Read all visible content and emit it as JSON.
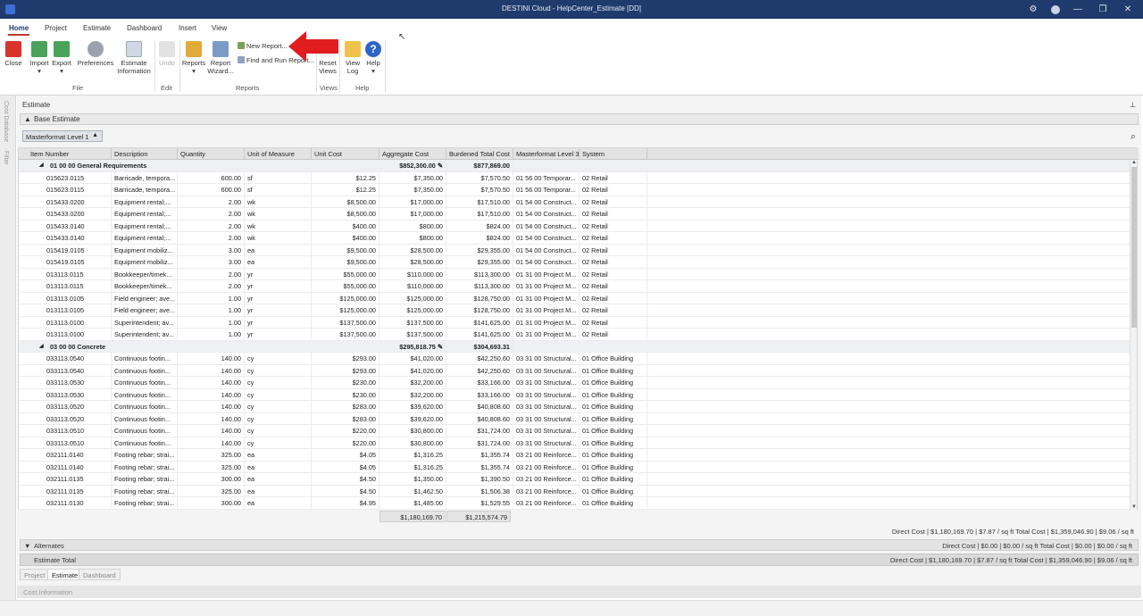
{
  "window": {
    "title": "DESTINI Cloud - HelpCenter_Estimate [DD]",
    "controls": [
      "—",
      "❐",
      "✕"
    ]
  },
  "menu": {
    "tabs": [
      "Home",
      "Project",
      "Estimate",
      "Dashboard",
      "Insert",
      "View"
    ],
    "active": "Home"
  },
  "ribbon": {
    "close": "Close",
    "import": "Import",
    "export": "Export",
    "preferences": "Preferences",
    "estimate_info": "Estimate Information",
    "undo": "Undo",
    "reports": "Reports",
    "report_wizard": "Report Wizard...",
    "new_report": "New Report...",
    "find_run_report": "Find and Run Report...",
    "reset_views": "Reset Views",
    "view_log": "View Log",
    "help": "Help",
    "groups": {
      "file": "File",
      "edit": "Edit",
      "reports": "Reports",
      "views": "Views",
      "help": "Help"
    }
  },
  "sidebar": {
    "cost_database": "Cost Database",
    "filter": "Filter"
  },
  "panel": {
    "title": "Estimate",
    "pin": "⊥",
    "base_estimate": "Base Estimate",
    "level_dropdown": "Masterformat Level 1"
  },
  "grid": {
    "columns": [
      "Item Number",
      "Description",
      "Quantity",
      "Unit of Measure",
      "Unit Cost",
      "Aggregate Cost",
      "Burdened Total Cost",
      "Masterformat Level 3",
      "System"
    ],
    "groups": [
      {
        "name": "01 00 00 General Requirements",
        "aggregate": "$852,300.00",
        "burdened": "$877,869.00",
        "rows": [
          [
            "015623.0115",
            "Barricade, tempora...",
            "600.00",
            "sf",
            "$12.25",
            "$7,350.00",
            "$7,570.50",
            "01 56 00 Temporar...",
            "02 Retail"
          ],
          [
            "015623.0115",
            "Barricade, tempora...",
            "600.00",
            "sf",
            "$12.25",
            "$7,350.00",
            "$7,570.50",
            "01 56 00 Temporar...",
            "02 Retail"
          ],
          [
            "015433.0200",
            "Equipment rental;...",
            "2.00",
            "wk",
            "$8,500.00",
            "$17,000.00",
            "$17,510.00",
            "01 54 00 Construct...",
            "02 Retail"
          ],
          [
            "015433.0200",
            "Equipment rental;...",
            "2.00",
            "wk",
            "$8,500.00",
            "$17,000.00",
            "$17,510.00",
            "01 54 00 Construct...",
            "02 Retail"
          ],
          [
            "015433.0140",
            "Equipment rental;...",
            "2.00",
            "wk",
            "$400.00",
            "$800.00",
            "$824.00",
            "01 54 00 Construct...",
            "02 Retail"
          ],
          [
            "015433.0140",
            "Equipment rental;...",
            "2.00",
            "wk",
            "$400.00",
            "$800.00",
            "$824.00",
            "01 54 00 Construct...",
            "02 Retail"
          ],
          [
            "015419.0105",
            "Equipment mobiliz...",
            "3.00",
            "ea",
            "$9,500.00",
            "$28,500.00",
            "$29,355.00",
            "01 54 00 Construct...",
            "02 Retail"
          ],
          [
            "015419.0105",
            "Equipment mobiliz...",
            "3.00",
            "ea",
            "$9,500.00",
            "$28,500.00",
            "$29,355.00",
            "01 54 00 Construct...",
            "02 Retail"
          ],
          [
            "013113.0115",
            "Bookkeeper/timek...",
            "2.00",
            "yr",
            "$55,000.00",
            "$110,000.00",
            "$113,300.00",
            "01 31 00 Project M...",
            "02 Retail"
          ],
          [
            "013113.0115",
            "Bookkeeper/timek...",
            "2.00",
            "yr",
            "$55,000.00",
            "$110,000.00",
            "$113,300.00",
            "01 31 00 Project M...",
            "02 Retail"
          ],
          [
            "013113.0105",
            "Field engineer; ave...",
            "1.00",
            "yr",
            "$125,000.00",
            "$125,000.00",
            "$128,750.00",
            "01 31 00 Project M...",
            "02 Retail"
          ],
          [
            "013113.0105",
            "Field engineer; ave...",
            "1.00",
            "yr",
            "$125,000.00",
            "$125,000.00",
            "$128,750.00",
            "01 31 00 Project M...",
            "02 Retail"
          ],
          [
            "013113.0100",
            "Superintendent; av...",
            "1.00",
            "yr",
            "$137,500.00",
            "$137,500.00",
            "$141,625.00",
            "01 31 00 Project M...",
            "02 Retail"
          ],
          [
            "013113.0100",
            "Superintendent; av...",
            "1.00",
            "yr",
            "$137,500.00",
            "$137,500.00",
            "$141,625.00",
            "01 31 00 Project M...",
            "02 Retail"
          ]
        ]
      },
      {
        "name": "03 00 00 Concrete",
        "aggregate": "$295,818.75",
        "burdened": "$304,693.31",
        "rows": [
          [
            "033113.0540",
            "Continuous footin...",
            "140.00",
            "cy",
            "$293.00",
            "$41,020.00",
            "$42,250.60",
            "03 31 00 Structural...",
            "01 Office Building"
          ],
          [
            "033113.0540",
            "Continuous footin...",
            "140.00",
            "cy",
            "$293.00",
            "$41,020.00",
            "$42,250.60",
            "03 31 00 Structural...",
            "01 Office Building"
          ],
          [
            "033113.0530",
            "Continuous footin...",
            "140.00",
            "cy",
            "$230.00",
            "$32,200.00",
            "$33,166.00",
            "03 31 00 Structural...",
            "01 Office Building"
          ],
          [
            "033113.0530",
            "Continuous footin...",
            "140.00",
            "cy",
            "$230.00",
            "$32,200.00",
            "$33,166.00",
            "03 31 00 Structural...",
            "01 Office Building"
          ],
          [
            "033113.0520",
            "Continuous footin...",
            "140.00",
            "cy",
            "$283.00",
            "$39,620.00",
            "$40,808.60",
            "03 31 00 Structural...",
            "01 Office Building"
          ],
          [
            "033113.0520",
            "Continuous footin...",
            "140.00",
            "cy",
            "$283.00",
            "$39,620.00",
            "$40,808.60",
            "03 31 00 Structural...",
            "01 Office Building"
          ],
          [
            "033113.0510",
            "Continuous footin...",
            "140.00",
            "cy",
            "$220.00",
            "$30,800.00",
            "$31,724.00",
            "03 31 00 Structural...",
            "01 Office Building"
          ],
          [
            "033113.0510",
            "Continuous footin...",
            "140.00",
            "cy",
            "$220.00",
            "$30,800.00",
            "$31,724.00",
            "03 31 00 Structural...",
            "01 Office Building"
          ],
          [
            "032111.0140",
            "Footing rebar; strai...",
            "325.00",
            "ea",
            "$4.05",
            "$1,316.25",
            "$1,355.74",
            "03 21 00 Reinforce...",
            "01 Office Building"
          ],
          [
            "032111.0140",
            "Footing rebar; strai...",
            "325.00",
            "ea",
            "$4.05",
            "$1,316.25",
            "$1,355.74",
            "03 21 00 Reinforce...",
            "01 Office Building"
          ],
          [
            "032111.0135",
            "Footing rebar; strai...",
            "300.00",
            "ea",
            "$4.50",
            "$1,350.00",
            "$1,390.50",
            "03 21 00 Reinforce...",
            "01 Office Building"
          ],
          [
            "032111.0135",
            "Footing rebar; strai...",
            "325.00",
            "ea",
            "$4.50",
            "$1,462.50",
            "$1,506.38",
            "03 21 00 Reinforce...",
            "01 Office Building"
          ],
          [
            "032111.0130",
            "Footing rebar; strai...",
            "300.00",
            "ea",
            "$4.95",
            "$1,485.00",
            "$1,529.55",
            "03 21 00 Reinforce...",
            "01 Office Building"
          ]
        ]
      }
    ],
    "totals": {
      "aggregate": "$1,180,169.70",
      "burdened": "$1,215,574.79"
    }
  },
  "summary": {
    "base": "Direct Cost | $1,180,169.70 | $7.87 / sq ft    Total Cost | $1,359,046.90 | $9.06 / sq ft",
    "alternates_label": "Alternates",
    "alternates": "Direct Cost | $0.00 | $0.00 / sq ft    Total Cost | $0.00 | $0.00 / sq ft",
    "estimate_total_label": "Estimate Total",
    "estimate_total": "Direct Cost | $1,180,169.70 | $7.87 / sq ft    Total Cost | $1,359,046.90 | $9.06 / sq ft"
  },
  "bottom_tabs": [
    "Project",
    "Estimate",
    "Dashboard"
  ],
  "bottom_active": "Estimate",
  "cost_info": "Cost Information",
  "colors": {
    "titlebar": "#1f3b6d",
    "accent_red": "#c0392b",
    "arrow": "#e01e1e"
  }
}
